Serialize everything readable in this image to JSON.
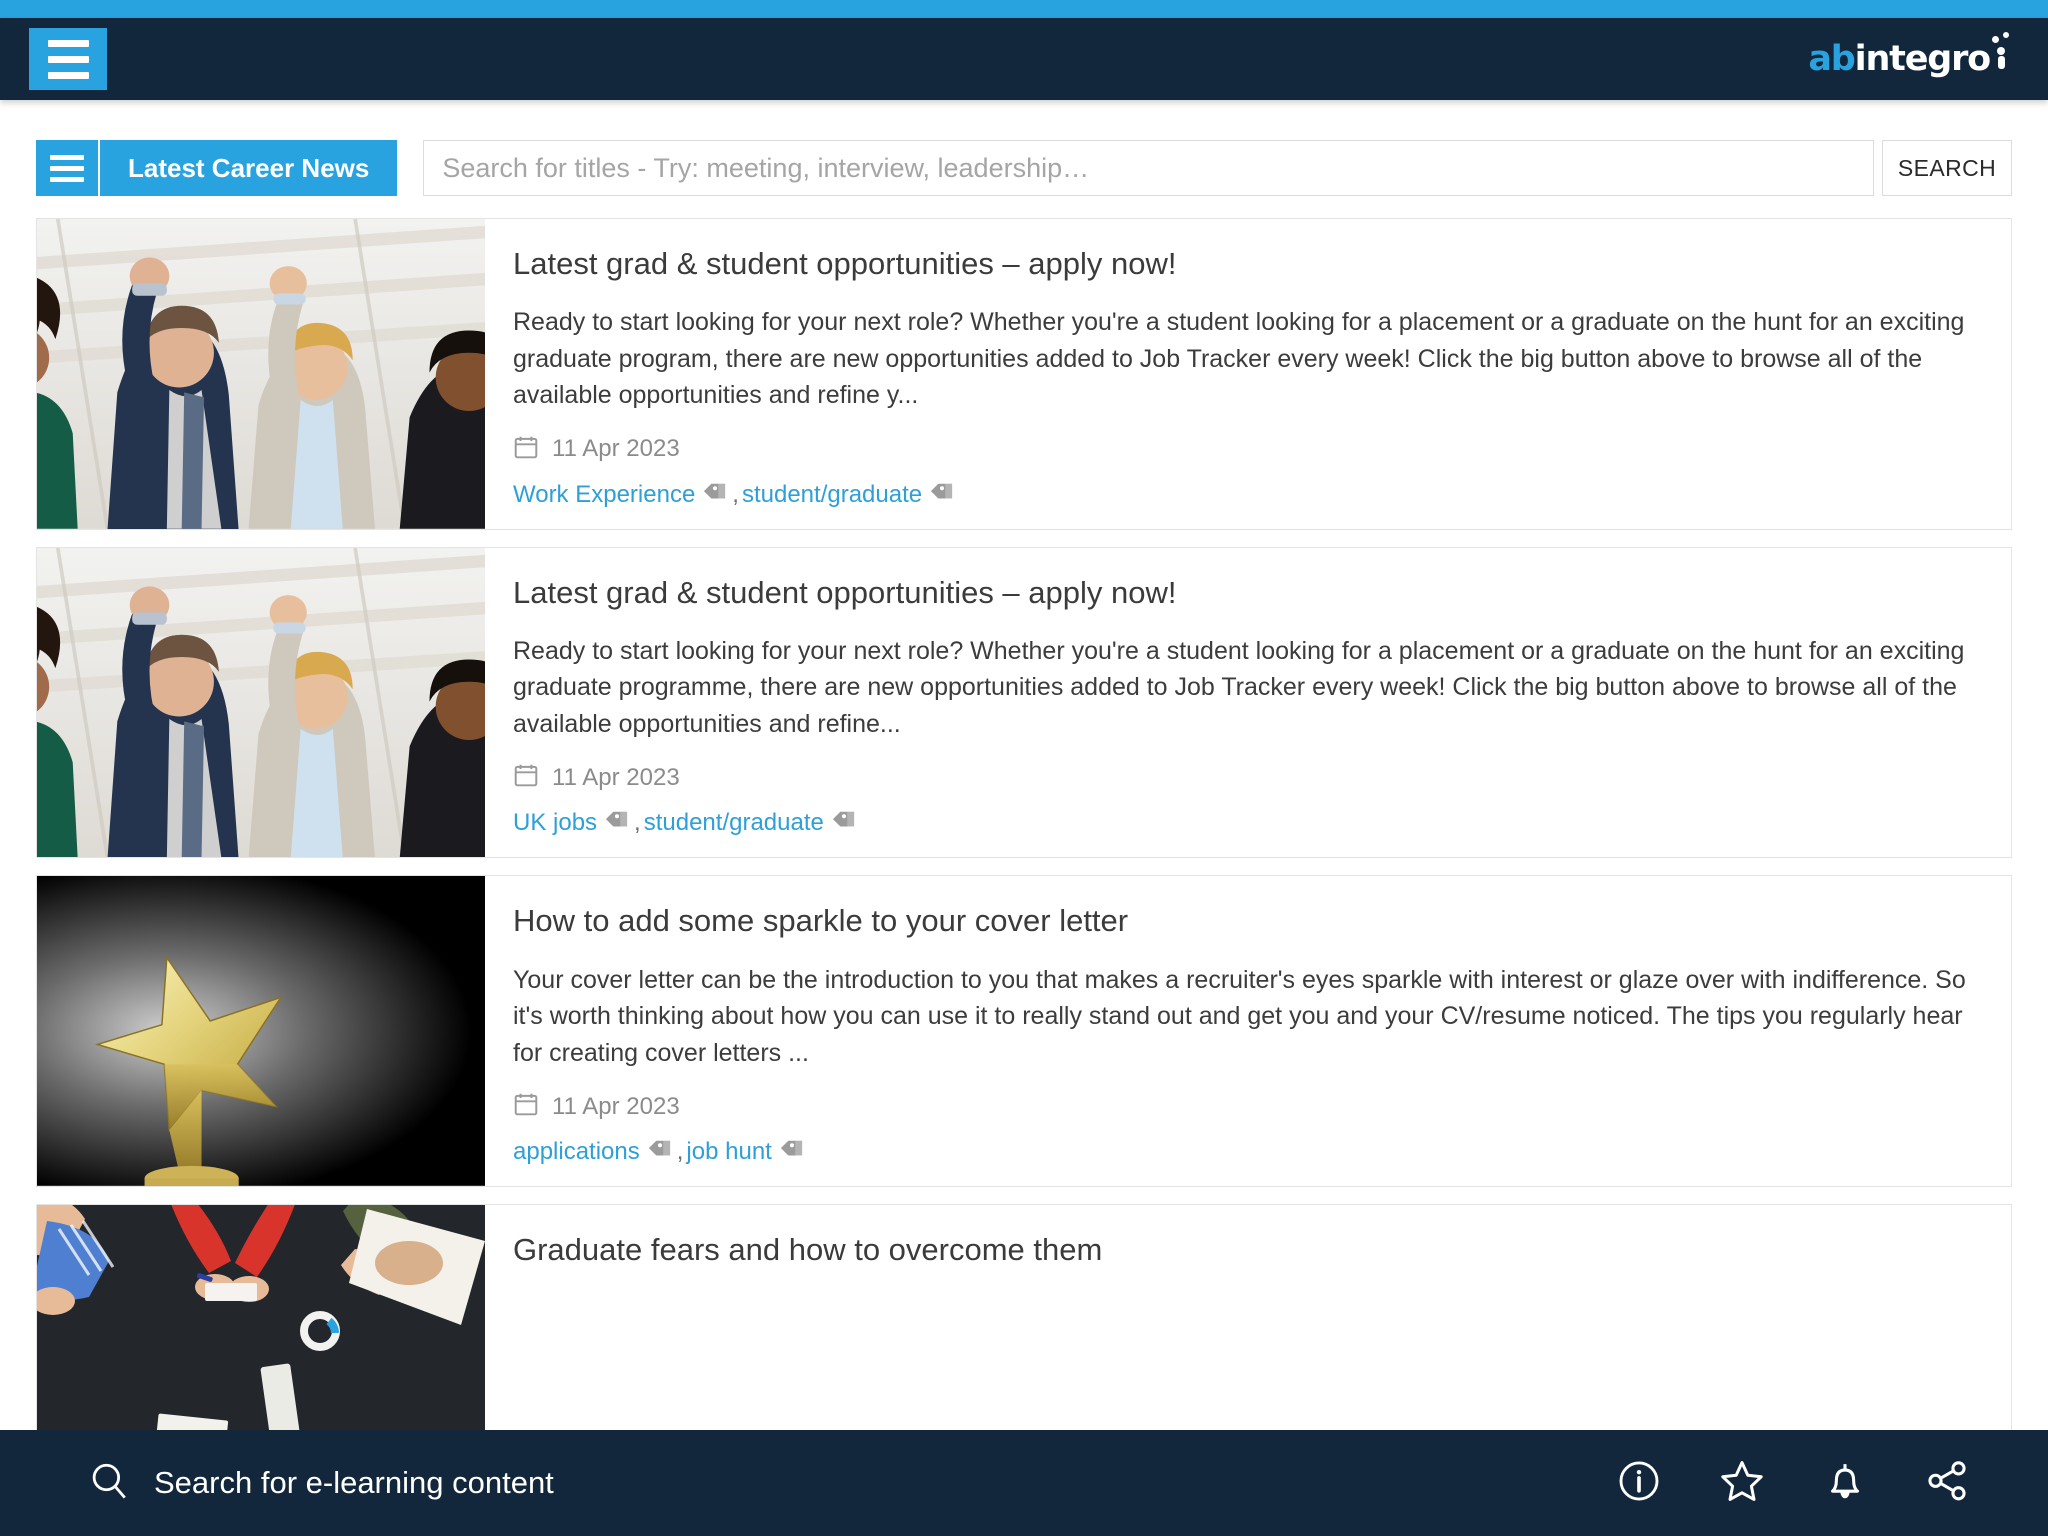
{
  "header": {
    "menu_button_label": "Menu",
    "brand": {
      "part1": "ab",
      "part2": "integro"
    },
    "accent_color": "#29a3e0",
    "bar_color": "#13273c"
  },
  "toolbar": {
    "list_toggle_name": "list-view-toggle",
    "section_tab_label": "Latest Career News",
    "search_placeholder": "Search for titles - Try: meeting, interview, leadership…",
    "search_value": "",
    "search_button_label": "SEARCH"
  },
  "articles": [
    {
      "title": "Latest grad & student opportunities – apply now!",
      "excerpt": "Ready to start looking for your next role? Whether you're a student looking for a placement or a graduate on the hunt for an exciting graduate program, there are new opportunities added to Job Tracker every week! Click the big button above to browse all of the available opportunities and refine y...",
      "date": "11 Apr 2023",
      "image": "celebrating-business-people",
      "tags": [
        "Work Experience",
        "student/graduate"
      ]
    },
    {
      "title": "Latest grad & student opportunities – apply now!",
      "excerpt": "Ready to start looking for your next role? Whether you're a student looking for a placement or a graduate on the hunt for an exciting graduate programme, there are new opportunities added to Job Tracker every week! Click the big button above to browse all of the available opportunities and refine...",
      "date": "11 Apr 2023",
      "image": "celebrating-business-people",
      "tags": [
        "UK jobs",
        "student/graduate"
      ]
    },
    {
      "title": "How to add some sparkle to your cover letter",
      "excerpt": "Your cover letter can be the introduction to you that makes a recruiter's eyes sparkle with interest or glaze over with indifference. So it's worth thinking about how you can use it to really stand out and get you and your CV/resume noticed. The tips you regularly hear for creating cover letters ...",
      "date": "11 Apr 2023",
      "image": "gold-star-trophy",
      "tags": [
        "applications",
        "job hunt"
      ]
    },
    {
      "title": "Graduate fears and how to overcome them",
      "excerpt": "",
      "date": "",
      "image": "team-meeting-overhead",
      "tags": []
    }
  ],
  "bottom_bar": {
    "search_label": "Search for e-learning content",
    "icons": [
      "info-icon",
      "star-icon",
      "bell-icon",
      "share-icon"
    ]
  }
}
